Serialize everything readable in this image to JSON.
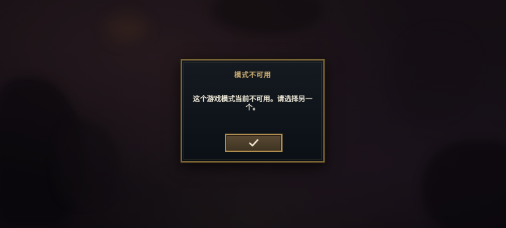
{
  "dialog": {
    "title": "模式不可用",
    "message": "这个游戏模式当前不可用。请选择另一个。",
    "confirm_icon": "check-icon"
  },
  "colors": {
    "border_gold": "#7a6335",
    "title_gold": "#c8aa6e",
    "message_text": "#ece6d6",
    "button_fill": "#4f4030",
    "dialog_bg": "#0f151b"
  }
}
